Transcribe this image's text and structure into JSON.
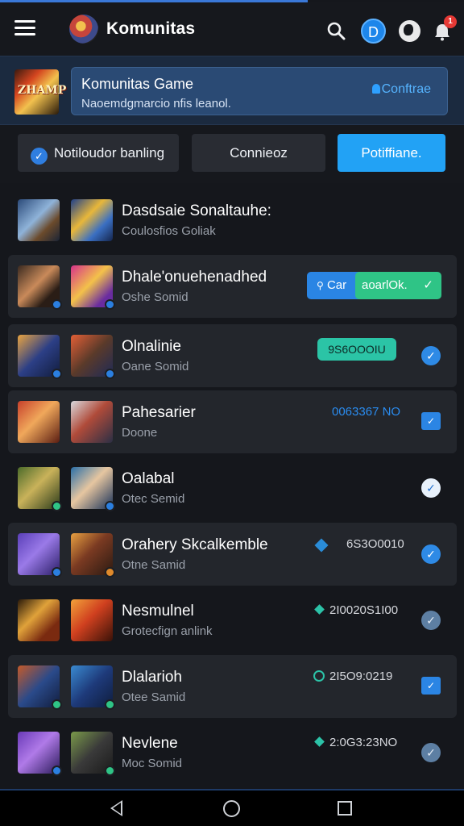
{
  "header": {
    "title": "Komunitas",
    "avatar_letter": "D",
    "notification_count": "1",
    "icons": [
      "menu-icon",
      "app-logo",
      "search-icon",
      "avatar",
      "globe-icon",
      "bell-icon"
    ]
  },
  "banner": {
    "thumb_text": "ZHAMP",
    "title": "Komunitas Game",
    "subtitle": "Naoemdgmarcio nfis leanol.",
    "action": "Conftrae"
  },
  "filters": [
    {
      "label": "Notiloudor banling"
    },
    {
      "label": "Connieoz"
    },
    {
      "label": "Potiffiane."
    }
  ],
  "list": [
    {
      "title": "Dasdsaie Sonaltauhe:",
      "subtitle": "Coulosfios Goliak",
      "stat": "",
      "status": "none"
    },
    {
      "title": "Dhale'onuehenadhed",
      "subtitle": "Oshe Somid",
      "badge_blue": "Car",
      "badge_green": "aoarlOk.",
      "stat": "",
      "status": "badge"
    },
    {
      "title": "Olnalinie",
      "subtitle": "Oane Somid",
      "stat": "9S6OOOIU",
      "status": "check"
    },
    {
      "title": "Pahesarier",
      "subtitle": "Doone",
      "stat": "0063367 NO",
      "status": "square"
    },
    {
      "title": "Oalabal",
      "subtitle": "Otec Semid",
      "stat": "",
      "status": "check"
    },
    {
      "title": "Orahery Skcalkemble",
      "subtitle": "Otne Samid",
      "stat": "6S3O0010",
      "status": "check"
    },
    {
      "title": "Nesmulnel",
      "subtitle": "Grotecfign anlink",
      "stat": "2I0020S1I00",
      "status": "check-dim"
    },
    {
      "title": "Dlalarioh",
      "subtitle": "Otee Samid",
      "stat": "2I5O9:0219",
      "status": "square"
    },
    {
      "title": "Nevlene",
      "subtitle": "Moc Somid",
      "stat": "2:0G3:23NO",
      "status": "check-dim"
    }
  ],
  "colors": {
    "accent_blue": "#22a2f5",
    "accent_green": "#2fc486",
    "teal": "#2cc3a8",
    "background": "#15171c"
  }
}
